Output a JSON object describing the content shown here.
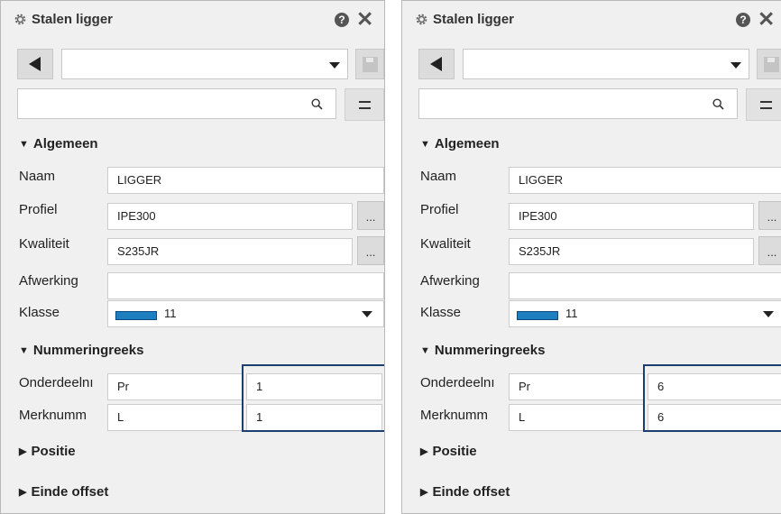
{
  "panels": [
    {
      "title": "Stalen ligger",
      "help_label": "?",
      "close_label": "✕",
      "preset_value": "",
      "search_value": "",
      "sections": {
        "general": "Algemeen",
        "numbering": "Nummeringreeks",
        "position": "Positie",
        "end_offset": "Einde offset"
      },
      "fields": {
        "naam": {
          "label": "Naam",
          "value": "LIGGER"
        },
        "profiel": {
          "label": "Profiel",
          "value": "IPE300"
        },
        "kwaliteit": {
          "label": "Kwaliteit",
          "value": "S235JR"
        },
        "afwerking": {
          "label": "Afwerking",
          "value": ""
        },
        "klasse": {
          "label": "Klasse",
          "value": "11",
          "swatch_color": "#1d7fc0"
        }
      },
      "numbering": {
        "part": {
          "label": "Onderdeelnı",
          "prefix": "Pr",
          "start": "1"
        },
        "assembly": {
          "label": "Merknumm",
          "prefix": "L",
          "start": "1"
        }
      },
      "browse_label": "..."
    },
    {
      "title": "Stalen ligger",
      "help_label": "?",
      "close_label": "✕",
      "preset_value": "",
      "search_value": "",
      "sections": {
        "general": "Algemeen",
        "numbering": "Nummeringreeks",
        "position": "Positie",
        "end_offset": "Einde offset"
      },
      "fields": {
        "naam": {
          "label": "Naam",
          "value": "LIGGER"
        },
        "profiel": {
          "label": "Profiel",
          "value": "IPE300"
        },
        "kwaliteit": {
          "label": "Kwaliteit",
          "value": "S235JR"
        },
        "afwerking": {
          "label": "Afwerking",
          "value": ""
        },
        "klasse": {
          "label": "Klasse",
          "value": "11",
          "swatch_color": "#1d7fc0"
        }
      },
      "numbering": {
        "part": {
          "label": "Onderdeelnı",
          "prefix": "Pr",
          "start": "6"
        },
        "assembly": {
          "label": "Merknumm",
          "prefix": "L",
          "start": "6"
        }
      },
      "browse_label": "..."
    }
  ],
  "colors": {
    "highlight_border": "#1b3f6e",
    "panel_bg": "#f0f0f0",
    "accent": "#1d7fc0"
  }
}
